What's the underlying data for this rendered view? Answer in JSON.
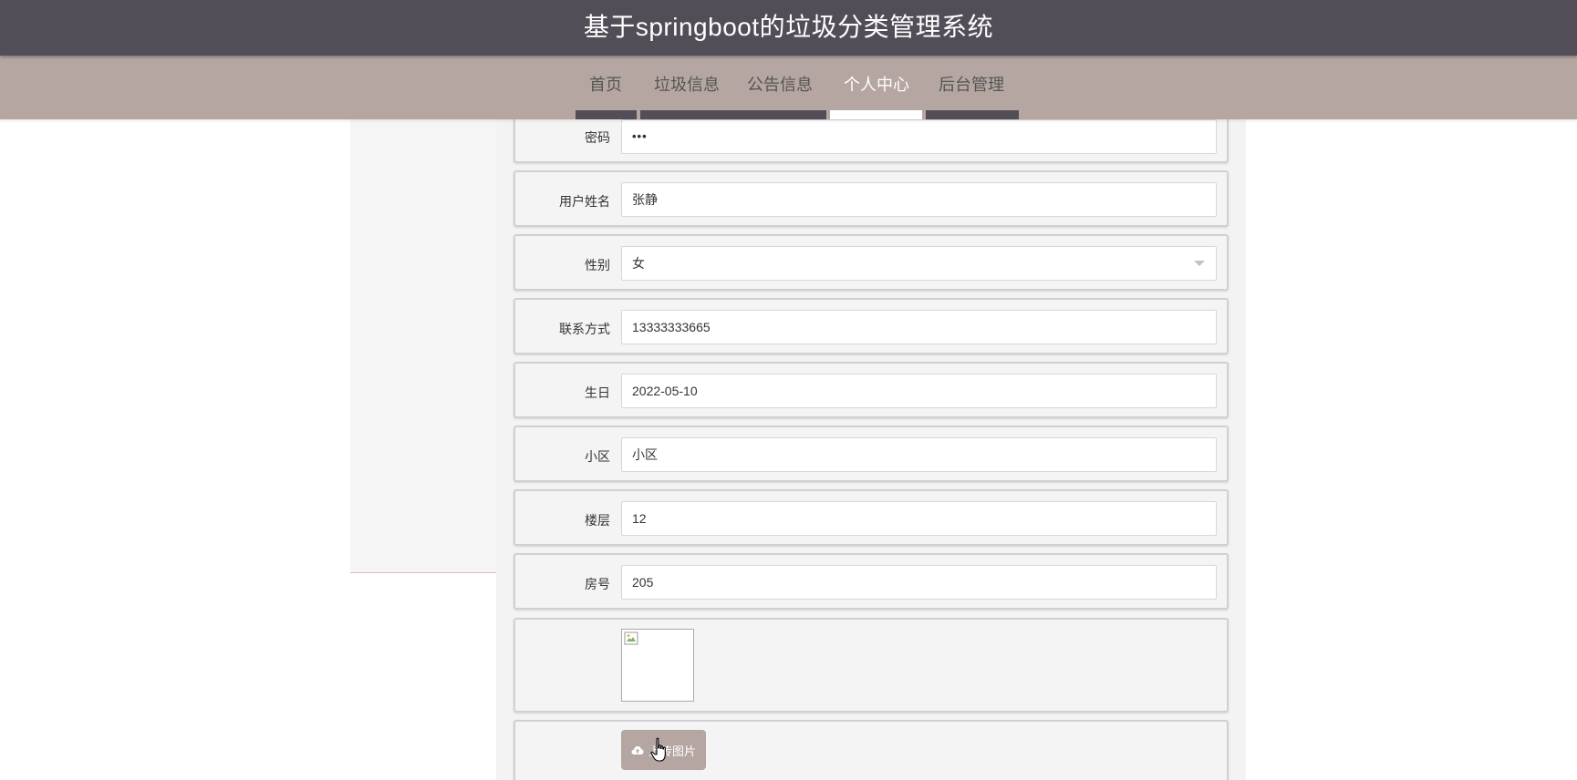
{
  "header": {
    "site_title": "基于springboot的垃圾分类管理系统"
  },
  "nav": {
    "items": [
      {
        "label": "首页"
      },
      {
        "label": "垃圾信息"
      },
      {
        "label": "公告信息"
      },
      {
        "label": "个人中心"
      },
      {
        "label": "后台管理"
      }
    ],
    "active_item": "个人中心"
  },
  "form": {
    "password": {
      "label": "密码",
      "value": "•••"
    },
    "username": {
      "label": "用户姓名",
      "value": "张静"
    },
    "gender": {
      "label": "性别",
      "value": "女"
    },
    "phone": {
      "label": "联系方式",
      "value": "13333333665"
    },
    "birthday": {
      "label": "生日",
      "value": "2022-05-10"
    },
    "community": {
      "label": "小区",
      "value": "小区"
    },
    "floor": {
      "label": "楼层",
      "value": "12"
    },
    "room": {
      "label": "房号",
      "value": "205"
    },
    "avatar": {
      "label": "",
      "image_state": "broken-image"
    },
    "upload": {
      "button_label": "上传图片",
      "icon": "cloud-upload-icon"
    }
  },
  "colors": {
    "title_bar": "#534d58",
    "nav_bar": "#b5a6a1",
    "nav_active_text": "#ffffff",
    "upload_button": "#b5a6a1"
  }
}
